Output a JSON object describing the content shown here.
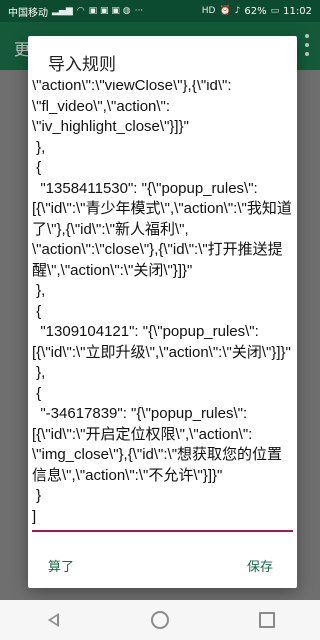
{
  "status_bar": {
    "carrier": "中国移动",
    "hd_label": "HD",
    "battery": "62%",
    "time": "11:02"
  },
  "app_bar": {
    "title_partial": "更"
  },
  "dialog": {
    "title": "导入规则",
    "content": "\\\"action\\\":\\\"viewClose\\\"},{\\\"id\\\":\n\\\"fl_video\\\",\\\"action\\\":\n\\\"iv_highlight_close\\\"}]}\"\n },\n {\n  \"1358411530\": \"{\\\"popup_rules\\\":\n[{\\\"id\\\":\\\"青少年模式\\\",\\\"action\\\":\\\"我知道了\\\"},{\\\"id\\\":\\\"新人福利\\\",\n\\\"action\\\":\\\"close\\\"},{\\\"id\\\":\\\"打开推送提醒\\\",\\\"action\\\":\\\"关闭\\\"}]}\"\n },\n {\n  \"1309104121\": \"{\\\"popup_rules\\\":\n[{\\\"id\\\":\\\"立即升级\\\",\\\"action\\\":\\\"关闭\\\"}]}\"\n },\n {\n  \"-34617839\": \"{\\\"popup_rules\\\":\n[{\\\"id\\\":\\\"开启定位权限\\\",\\\"action\\\":\n\\\"img_close\\\"},{\\\"id\\\":\\\"想获取您的位置信息\\\",\\\"action\\\":\\\"不允许\\\"}]}\"\n }\n]",
    "cancel_label": "算了",
    "save_label": "保存",
    "accent_color": "#a01850",
    "button_color": "#1b6a47"
  },
  "nav_bar": {
    "back_icon": "back-triangle",
    "home_icon": "home-circle",
    "recent_icon": "recent-square"
  }
}
